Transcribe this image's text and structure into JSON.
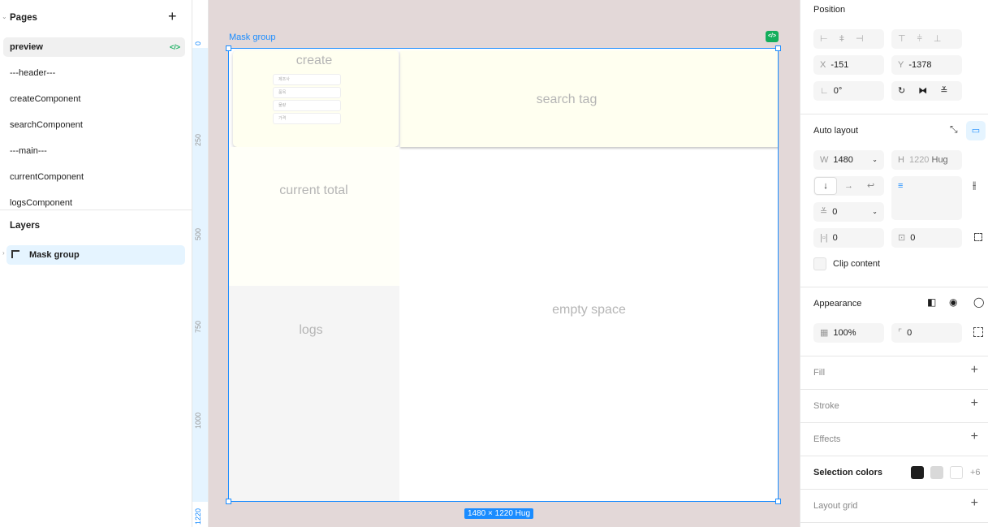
{
  "pages": {
    "title": "Pages",
    "items": [
      "preview",
      "---header---",
      "createComponent",
      "searchComponent",
      "---main---",
      "currentComponent",
      "logsComponent"
    ]
  },
  "layers": {
    "title": "Layers",
    "items": [
      "Mask group"
    ]
  },
  "ruler": [
    "0",
    "250",
    "500",
    "750",
    "1000",
    "1220"
  ],
  "canvas": {
    "frame_label": "Mask group",
    "size_badge": "1480 × 1220 Hug",
    "create": {
      "title": "create",
      "placeholders": [
        "제조사",
        "품목",
        "물량",
        "가격"
      ]
    },
    "search": "search tag",
    "current": "current total",
    "logs": "logs",
    "empty": "empty space"
  },
  "props": {
    "position": {
      "title": "Position",
      "x_label": "X",
      "x": "-151",
      "y_label": "Y",
      "y": "-1378",
      "rotation": "0°"
    },
    "auto_layout": {
      "title": "Auto layout",
      "w_label": "W",
      "w": "1480",
      "h_label": "H",
      "h": "1220",
      "h_mode": "Hug",
      "gap": "0",
      "pad_h": "0",
      "pad_v": "0",
      "clip": "Clip content"
    },
    "appearance": {
      "title": "Appearance",
      "opacity": "100%",
      "radius": "0"
    },
    "fill": "Fill",
    "stroke": "Stroke",
    "effects": "Effects",
    "selection_colors": {
      "title": "Selection colors",
      "colors": [
        "#1e1e1e",
        "#d9d9d9",
        "#ffffff"
      ],
      "more": "+6"
    },
    "layout_grid": "Layout grid"
  }
}
